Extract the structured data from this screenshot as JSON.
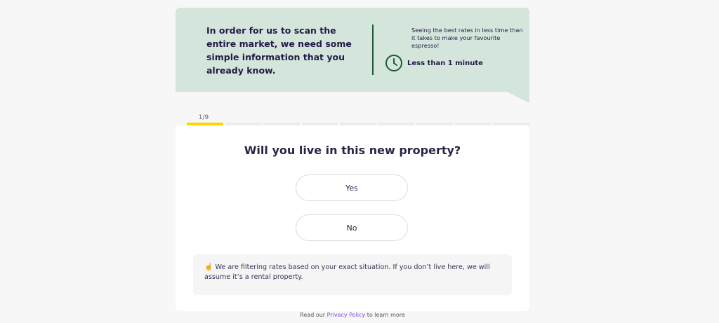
{
  "banner": {
    "headline": "In order for us to scan the entire market, we need some simple information that you already know.",
    "aside": "Seeing the best rates in less time than it takes to make your favourite espresso!",
    "duration_label": "Less than 1 minute",
    "duration_icon": "clock-icon",
    "accent_color": "#1f5a35",
    "background_color": "#d4e6dc"
  },
  "progress": {
    "step_label": "1/9",
    "current_step": 1,
    "total_steps": 9,
    "active_color": "#ffd500"
  },
  "question": {
    "title": "Will you live in this new property?",
    "options": [
      {
        "label": "Yes"
      },
      {
        "label": "No"
      }
    ]
  },
  "note": {
    "emoji": "☝️",
    "text": "We are filtering rates based on your exact situation. If you don’t live here, we will assume it’s a rental property."
  },
  "footer": {
    "prefix": "Read our",
    "link_text": "Privacy Policy",
    "suffix": "to learn more",
    "link_color": "#7a47e0"
  }
}
